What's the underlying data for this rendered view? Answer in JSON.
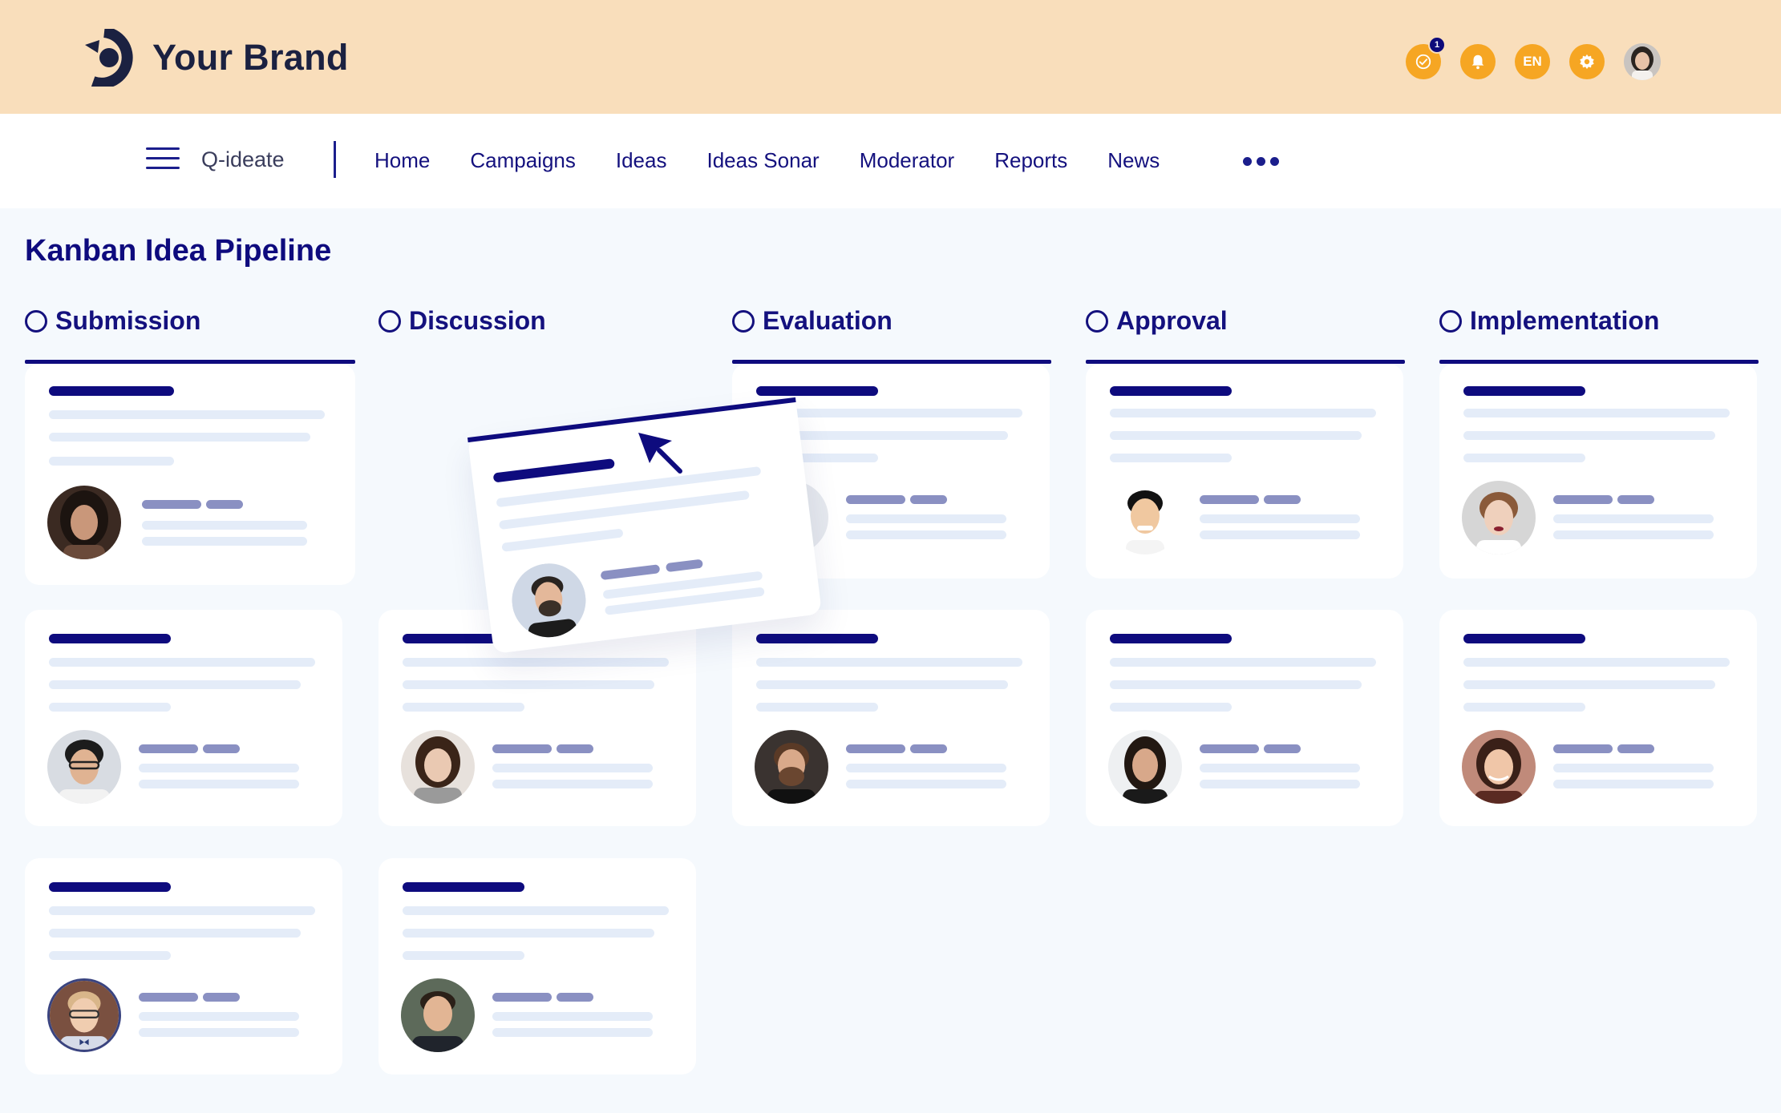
{
  "brand": {
    "name": "Your Brand",
    "logo_icon": "brand-logo-icon"
  },
  "header": {
    "actions": [
      {
        "name": "tasks-check-icon",
        "badge": "1"
      },
      {
        "name": "bell-icon"
      },
      {
        "name": "language",
        "label": "EN"
      },
      {
        "name": "gear-icon"
      },
      {
        "name": "user-avatar"
      }
    ],
    "colors": {
      "header_bg": "#f9debb",
      "accent": "#f6a623",
      "primary": "#0e0b7e"
    }
  },
  "nav": {
    "product": "Q-ideate",
    "items": [
      "Home",
      "Campaigns",
      "Ideas",
      "Ideas Sonar",
      "Moderator",
      "Reports",
      "News"
    ],
    "more_icon": "more-horizontal-icon"
  },
  "page": {
    "title": "Kanban Idea Pipeline"
  },
  "columns": [
    {
      "title": "Submission"
    },
    {
      "title": "Discussion"
    },
    {
      "title": "Evaluation"
    },
    {
      "title": "Approval"
    },
    {
      "title": "Implementation"
    }
  ]
}
